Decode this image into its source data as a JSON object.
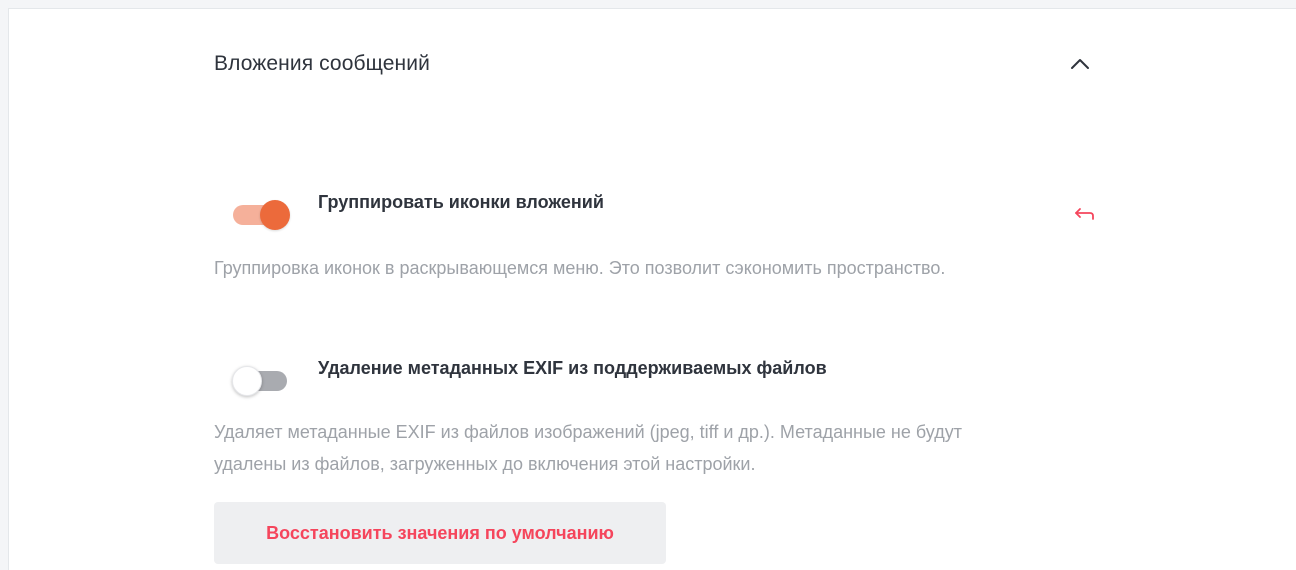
{
  "section": {
    "title": "Вложения сообщений",
    "collapse_icon": "chevron-up-icon"
  },
  "settings": [
    {
      "label": "Группировать иконки вложений",
      "description": "Группировка иконок в раскрывающемся меню. Это позволит сэкономить пространство.",
      "enabled": true,
      "reset_icon": "undo-arrow-icon"
    },
    {
      "label": "Удаление метаданных EXIF из поддерживаемых файлов",
      "description": "Удаляет метаданные EXIF из файлов изображений (jpeg, tiff и др.). Метаданные не будут удалены из файлов, загруженных до включения этой настройки.",
      "enabled": false
    }
  ],
  "restore_button": {
    "label": "Восстановить значения по умолчанию"
  },
  "colors": {
    "toggle_on_thumb": "#ec6a3b",
    "toggle_on_track": "#f5b09a",
    "toggle_off_track": "#a9abb0",
    "danger": "#f5455c",
    "muted_text": "#9ea2a8",
    "primary_text": "#2f343d",
    "button_bg": "#eeeff1"
  }
}
